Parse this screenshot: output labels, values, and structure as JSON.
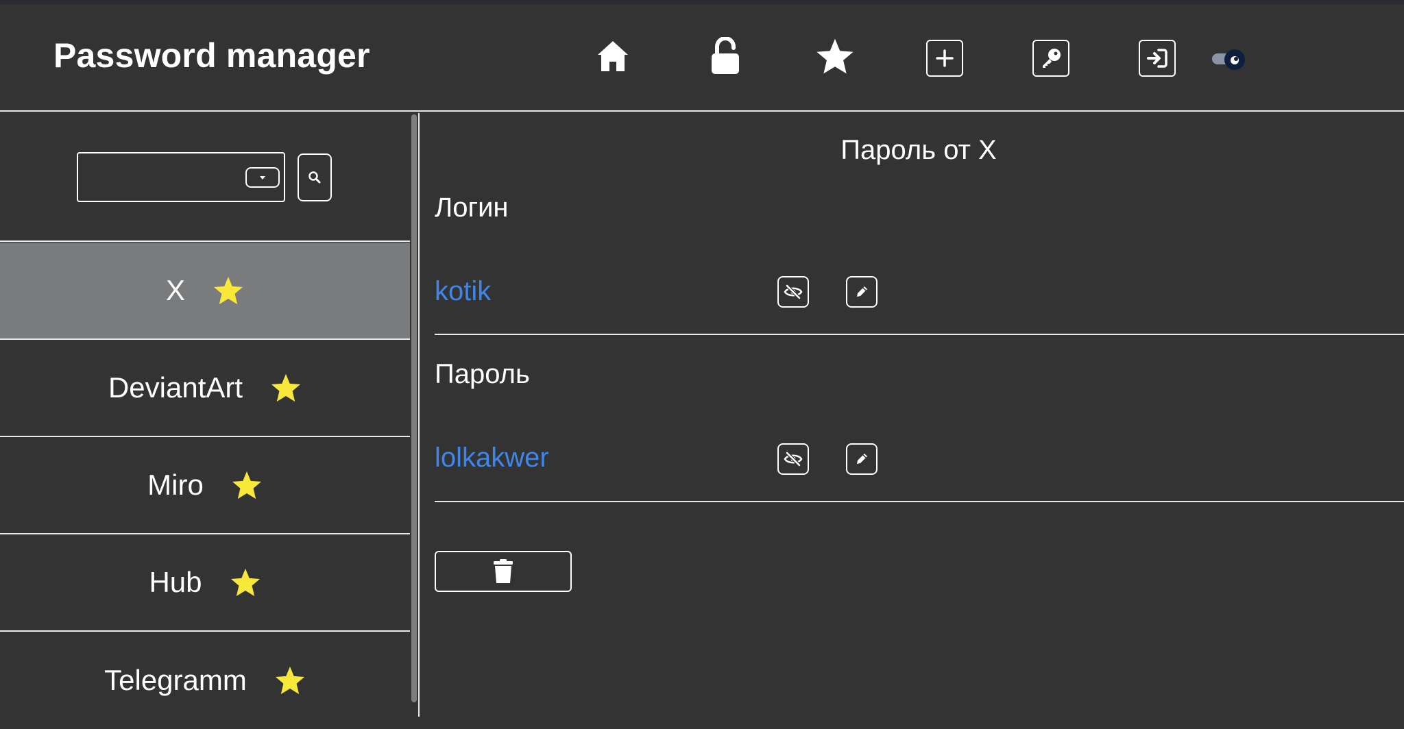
{
  "header": {
    "title": "Password manager",
    "icons": [
      "home-icon",
      "unlock-icon",
      "star-icon",
      "plus-icon",
      "key-icon",
      "login-icon"
    ],
    "theme_toggle": "eye-icon"
  },
  "sidebar": {
    "search": {
      "value": "",
      "dropdown_icon": "caret-down-icon",
      "search_icon": "search-icon"
    },
    "items": [
      {
        "label": "X",
        "favorite": true,
        "selected": true
      },
      {
        "label": "DeviantArt",
        "favorite": true,
        "selected": false
      },
      {
        "label": "Miro",
        "favorite": true,
        "selected": false
      },
      {
        "label": "Hub",
        "favorite": true,
        "selected": false
      },
      {
        "label": "Telegramm",
        "favorite": true,
        "selected": false
      }
    ]
  },
  "detail": {
    "title": "Пароль от X",
    "login_label": "Логин",
    "login_value": "kotik",
    "password_label": "Пароль",
    "password_value": "lolkakwer",
    "delete_icon": "trash-icon"
  },
  "colors": {
    "background": "#333333",
    "selected_item": "#7a7b7d",
    "link_value": "#3f86e8",
    "star": "#f7e83a",
    "divider": "#e9e9e9"
  }
}
